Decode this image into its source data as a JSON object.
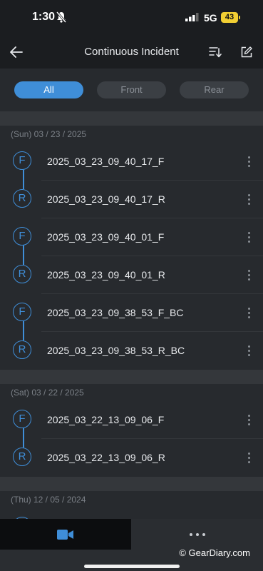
{
  "status_bar": {
    "time": "1:30",
    "network": "5G",
    "battery": "43"
  },
  "navbar": {
    "title": "Continuous Incident"
  },
  "filters": [
    {
      "label": "All",
      "active": true
    },
    {
      "label": "Front",
      "active": false
    },
    {
      "label": "Rear",
      "active": false
    }
  ],
  "groups": [
    {
      "date": "(Sun) 03 / 23 / 2025",
      "items": [
        {
          "badge": "F",
          "name": "2025_03_23_09_40_17_F"
        },
        {
          "badge": "R",
          "name": "2025_03_23_09_40_17_R"
        },
        {
          "badge": "F",
          "name": "2025_03_23_09_40_01_F"
        },
        {
          "badge": "R",
          "name": "2025_03_23_09_40_01_R"
        },
        {
          "badge": "F",
          "name": "2025_03_23_09_38_53_F_BC"
        },
        {
          "badge": "R",
          "name": "2025_03_23_09_38_53_R_BC"
        }
      ]
    },
    {
      "date": "(Sat) 03 / 22 / 2025",
      "items": [
        {
          "badge": "F",
          "name": "2025_03_22_13_09_06_F"
        },
        {
          "badge": "R",
          "name": "2025_03_22_13_09_06_R"
        }
      ]
    },
    {
      "date": "(Thu) 12 / 05 / 2024",
      "items": [
        {
          "badge": "",
          "name": ""
        }
      ]
    }
  ],
  "watermark": "© GearDiary.com",
  "colors": {
    "accent": "#3f8ed8",
    "background": "#272a2e",
    "bar": "#1b1d20",
    "battery": "#f2cf33"
  },
  "icons": [
    "bell-slash-icon",
    "signal-icon",
    "back-arrow-icon",
    "sort-icon",
    "edit-icon",
    "more-vertical-icon",
    "video-camera-icon",
    "more-horizontal-icon"
  ]
}
